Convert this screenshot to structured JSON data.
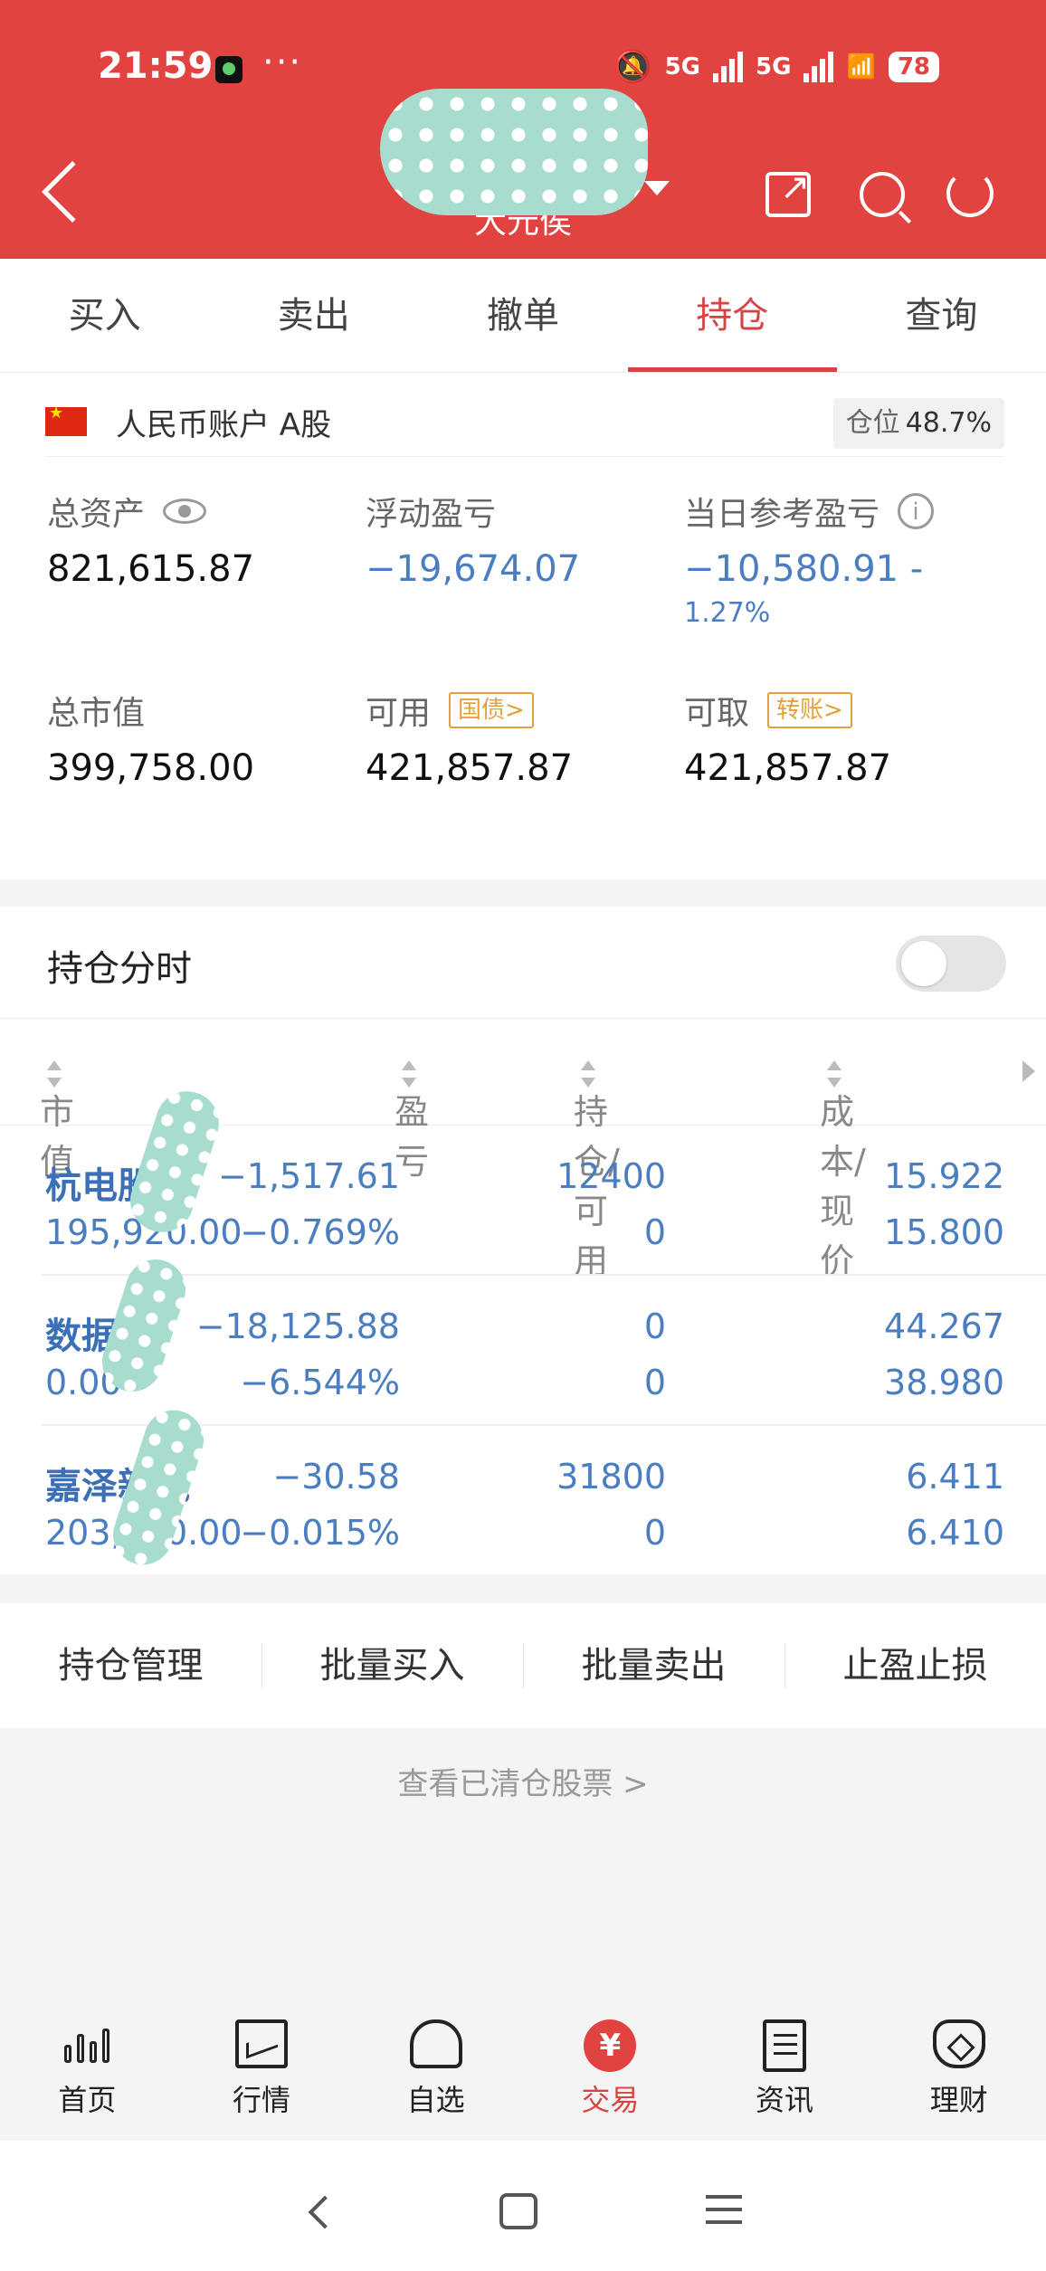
{
  "status_bar": {
    "time": "21:59",
    "dots": "···",
    "network_1": "5G",
    "network_2": "5G",
    "battery": "78"
  },
  "header": {
    "title": "大元侯",
    "icons": [
      "back-icon",
      "dropdown-caret-icon",
      "share-icon",
      "search-icon",
      "refresh-icon"
    ]
  },
  "tabs": [
    {
      "label": "买入"
    },
    {
      "label": "卖出"
    },
    {
      "label": "撤单"
    },
    {
      "label": "持仓",
      "active": true
    },
    {
      "label": "查询"
    }
  ],
  "account": {
    "name": "人民币账户 A股",
    "position_label": "仓位",
    "position_value": "48.7%",
    "total_assets_label": "总资产",
    "total_assets": "821,615.87",
    "float_pl_label": "浮动盈亏",
    "float_pl": "−19,674.07",
    "daily_pl_label": "当日参考盈亏",
    "daily_pl": "−10,580.91 -",
    "daily_pl_pct": "1.27%",
    "market_value_label": "总市值",
    "market_value": "399,758.00",
    "available_label": "可用",
    "available_tag": "国债>",
    "available": "421,857.87",
    "withdrawable_label": "可取",
    "withdrawable_tag": "转账>",
    "withdrawable": "421,857.87"
  },
  "holdings": {
    "title": "持仓分时",
    "columns": [
      "市值",
      "盈亏",
      "持仓/可用",
      "成本/现价"
    ],
    "rows": [
      {
        "name": "杭电股份",
        "market_value": "195,920.00",
        "pl": "−1,517.61",
        "pl_pct": "−0.769%",
        "hold": "12400",
        "available": "0",
        "cost": "15.922",
        "price": "15.800"
      },
      {
        "name": "数据港",
        "market_value": "0.00",
        "pl": "−18,125.88",
        "pl_pct": "−6.544%",
        "hold": "0",
        "available": "0",
        "cost": "44.267",
        "price": "38.980"
      },
      {
        "name": "嘉泽新能",
        "market_value": "203,850.00",
        "pl": "−30.58",
        "pl_pct": "−0.015%",
        "hold": "31800",
        "available": "0",
        "cost": "6.411",
        "price": "6.410"
      }
    ]
  },
  "actions": [
    "持仓管理",
    "批量买入",
    "批量卖出",
    "止盈止损"
  ],
  "cleared_link": "查看已清仓股票 >",
  "bottom_nav": [
    {
      "label": "首页"
    },
    {
      "label": "行情"
    },
    {
      "label": "自选"
    },
    {
      "label": "交易",
      "active": true
    },
    {
      "label": "资讯"
    },
    {
      "label": "理财"
    }
  ],
  "colors": {
    "brand_red": "#e04340",
    "negative_blue": "#4a7ec1",
    "tag_orange": "#e3a13b"
  }
}
